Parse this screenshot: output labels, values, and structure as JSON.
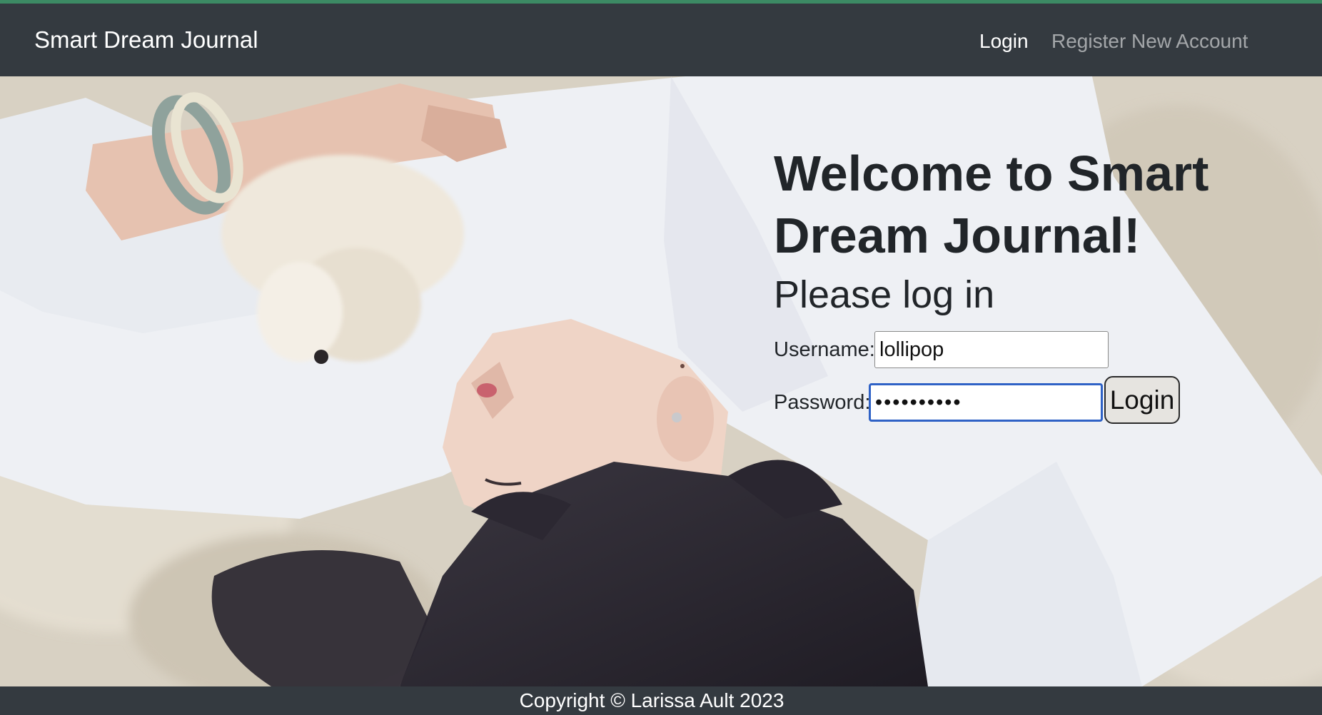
{
  "navbar": {
    "brand": "Smart Dream Journal",
    "links": [
      {
        "label": "Login",
        "active": true
      },
      {
        "label": "Register New Account",
        "active": false
      }
    ]
  },
  "main": {
    "heading": "Welcome to Smart Dream Journal!",
    "subheading": "Please log in",
    "form": {
      "username_label": "Username:",
      "username_value": "lollipop",
      "password_label": "Password:",
      "password_value": "••••••••••",
      "submit_label": "Login"
    }
  },
  "footer": {
    "copyright": "Copyright © Larissa Ault 2023"
  },
  "colors": {
    "navbar_bg": "#343a40",
    "accent_top": "#3c8a64",
    "focus_border": "#2f62c6"
  }
}
